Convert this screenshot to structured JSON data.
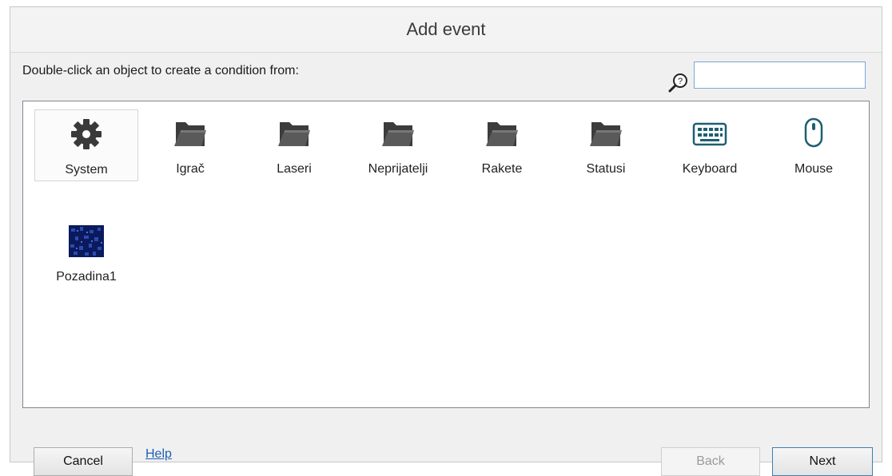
{
  "dialog": {
    "title": "Add event",
    "instruction": "Double-click an object to create a condition from:"
  },
  "search": {
    "placeholder": "",
    "value": "",
    "icon": "search-help-icon"
  },
  "objects": [
    {
      "label": "System",
      "icon": "gear-icon",
      "selected": true
    },
    {
      "label": "Igrač",
      "icon": "folder-icon"
    },
    {
      "label": "Laseri",
      "icon": "folder-icon"
    },
    {
      "label": "Neprijatelji",
      "icon": "folder-icon"
    },
    {
      "label": "Rakete",
      "icon": "folder-icon"
    },
    {
      "label": "Statusi",
      "icon": "folder-icon"
    },
    {
      "label": "Keyboard",
      "icon": "keyboard-icon"
    },
    {
      "label": "Mouse",
      "icon": "mouse-icon"
    },
    {
      "label": "Pozadina1",
      "icon": "tiled-background-icon"
    }
  ],
  "footer": {
    "cancel_label": "Cancel",
    "help_label": "Help",
    "back_label": "Back",
    "back_disabled": true,
    "next_label": "Next"
  },
  "colors": {
    "link": "#1e5fb4",
    "search_border": "#7aa7d8",
    "default_button_border": "#3c7fb1",
    "background_thumb": "#0a1a5c"
  }
}
